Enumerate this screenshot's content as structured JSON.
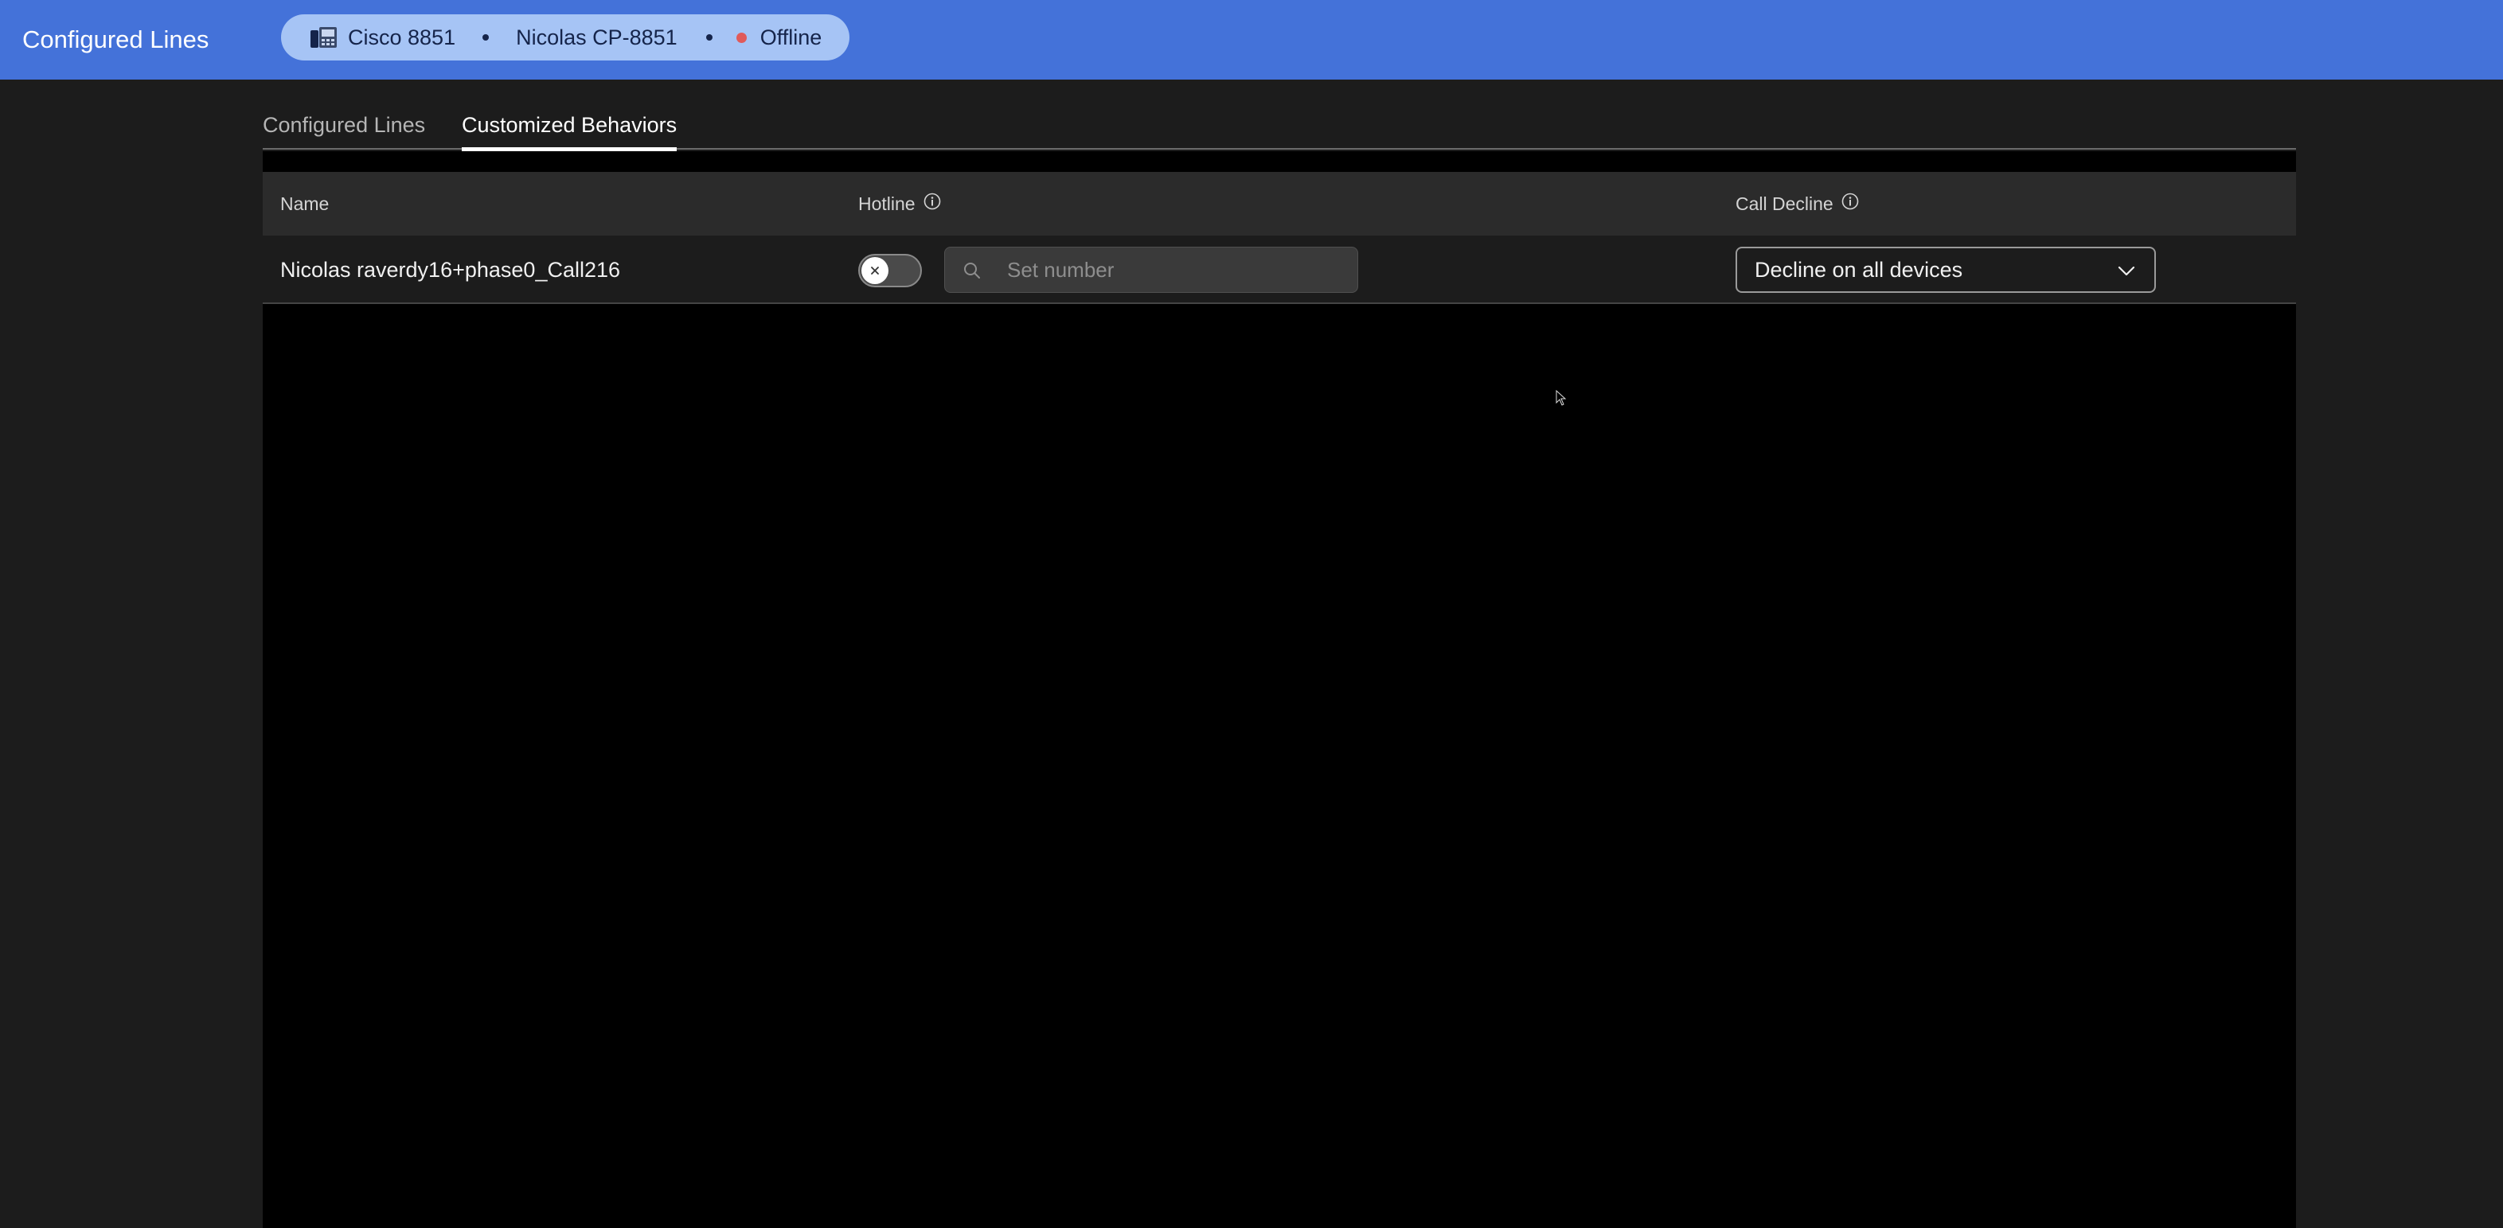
{
  "header": {
    "title": "Configured Lines",
    "device": {
      "model": "Cisco 8851",
      "name": "Nicolas CP-8851",
      "status": "Offline",
      "status_color": "#e05a5a"
    }
  },
  "tabs": [
    {
      "label": "Configured Lines",
      "active": false
    },
    {
      "label": "Customized Behaviors",
      "active": true
    }
  ],
  "table": {
    "columns": {
      "name": "Name",
      "hotline": "Hotline",
      "call_decline": "Call Decline"
    },
    "rows": [
      {
        "name": "Nicolas raverdy16+phase0_Call216",
        "hotline_enabled": false,
        "hotline_placeholder": "Set number",
        "call_decline": "Decline on all devices"
      }
    ]
  },
  "colors": {
    "header_bg": "#4472d9",
    "pill_bg": "#a6c4f5",
    "page_bg": "#1c1c1c"
  },
  "icons": [
    "desk-phone-icon",
    "info-icon",
    "search-icon",
    "close-icon",
    "chevron-down-icon",
    "mouse-cursor-icon"
  ]
}
